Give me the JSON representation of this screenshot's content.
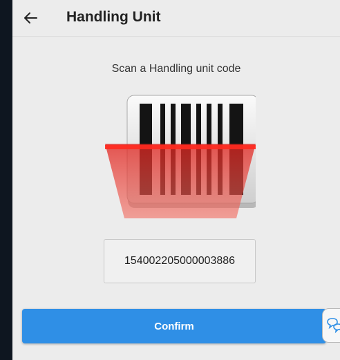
{
  "header": {
    "title": "Handling Unit",
    "back_icon": "back-arrow-icon"
  },
  "scan": {
    "instruction": "Scan a Handling unit code",
    "illustration_icon": "barcode-scanner-icon"
  },
  "code_field": {
    "value": "154002205000003886"
  },
  "actions": {
    "confirm_label": "Confirm",
    "chat_icon": "chat-bubbles-icon"
  },
  "colors": {
    "background": "#ececec",
    "primary_button": "#2f8fe6",
    "scanner_red": "#e0231e"
  }
}
